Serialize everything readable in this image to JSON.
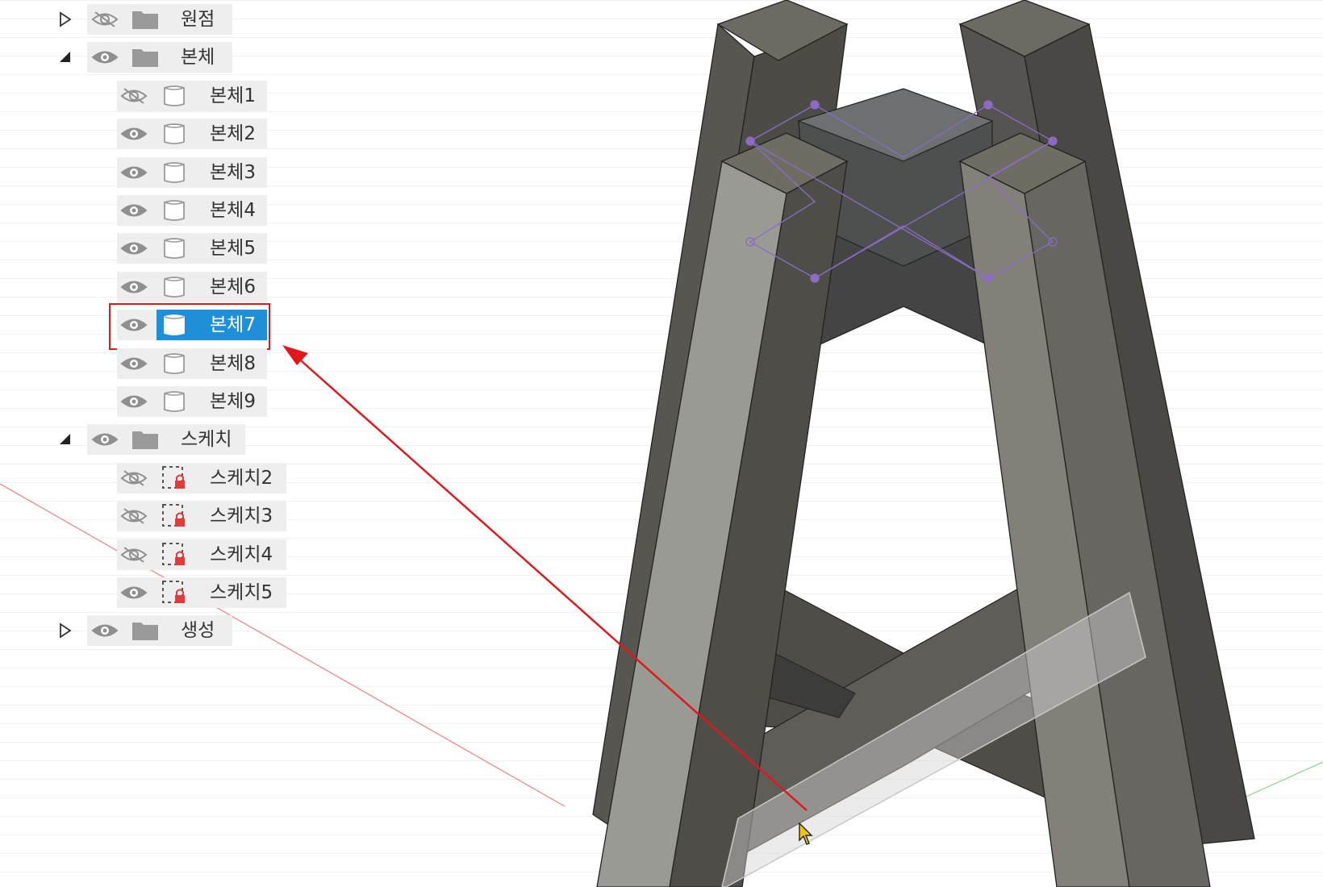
{
  "colors": {
    "grid": "#dcdcdc",
    "axis_red": "#f08080",
    "axis_green": "#7fd57f",
    "selection": "#1f8fd8",
    "annotation": "#e0181b",
    "sketch_line": "#8a6cc4"
  },
  "browser": {
    "groups": [
      {
        "label": "원점",
        "expanded": false,
        "visible": false,
        "icon": "folder-icon"
      },
      {
        "label": "본체",
        "expanded": true,
        "visible": true,
        "icon": "folder-icon",
        "items": [
          {
            "label": "본체1",
            "visible": false,
            "icon": "body-icon"
          },
          {
            "label": "본체2",
            "visible": true,
            "icon": "body-icon"
          },
          {
            "label": "본체3",
            "visible": true,
            "icon": "body-icon"
          },
          {
            "label": "본체4",
            "visible": true,
            "icon": "body-icon"
          },
          {
            "label": "본체5",
            "visible": true,
            "icon": "body-icon"
          },
          {
            "label": "본체6",
            "visible": true,
            "icon": "body-icon"
          },
          {
            "label": "본체7",
            "visible": true,
            "icon": "body-icon",
            "selected": true
          },
          {
            "label": "본체8",
            "visible": true,
            "icon": "body-icon"
          },
          {
            "label": "본체9",
            "visible": true,
            "icon": "body-icon"
          }
        ]
      },
      {
        "label": "스케치",
        "expanded": true,
        "visible": true,
        "icon": "folder-icon",
        "items": [
          {
            "label": "스케치2",
            "visible": false,
            "icon": "sketch-icon"
          },
          {
            "label": "스케치3",
            "visible": false,
            "icon": "sketch-icon"
          },
          {
            "label": "스케치4",
            "visible": false,
            "icon": "sketch-icon"
          },
          {
            "label": "스케치5",
            "visible": true,
            "icon": "sketch-icon"
          }
        ]
      },
      {
        "label": "생성",
        "expanded": false,
        "visible": true,
        "icon": "folder-icon"
      }
    ]
  }
}
